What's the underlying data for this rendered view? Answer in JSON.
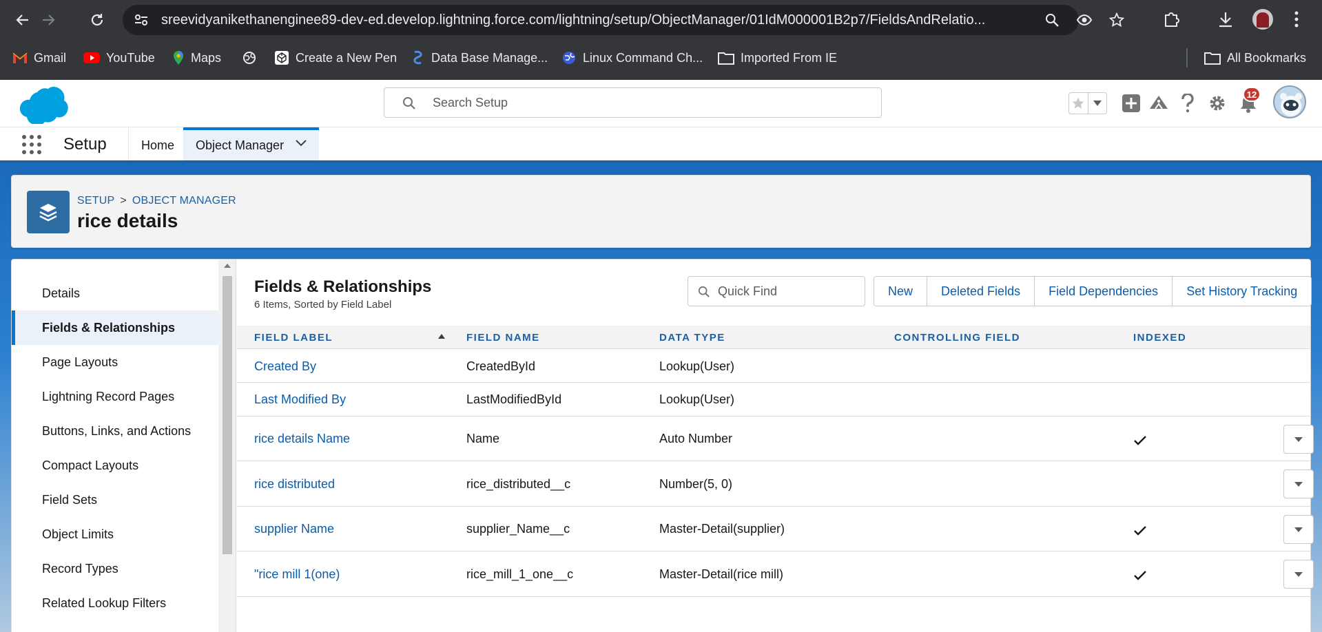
{
  "browser": {
    "url": "sreevidyanikethanenginee89-dev-ed.develop.lightning.force.com/lightning/setup/ObjectManager/01IdM000001B2p7/FieldsAndRelatio...",
    "bookmarks": [
      {
        "label": "Gmail",
        "icon": "gmail-icon"
      },
      {
        "label": "YouTube",
        "icon": "youtube-icon"
      },
      {
        "label": "Maps",
        "icon": "maps-icon"
      },
      {
        "label": "",
        "icon": "globe-icon"
      },
      {
        "label": "Create a New Pen",
        "icon": "codepen-icon"
      },
      {
        "label": "Data Base Manage...",
        "icon": "database-icon"
      },
      {
        "label": "Linux Command Ch...",
        "icon": "globe-blue-icon"
      },
      {
        "label": "Imported From IE",
        "icon": "folder-icon"
      }
    ],
    "all_bookmarks": "All Bookmarks"
  },
  "header": {
    "search_placeholder": "Search Setup",
    "notification_count": "12"
  },
  "appnav": {
    "app_name": "Setup",
    "tabs": [
      "Home",
      "Object Manager"
    ]
  },
  "page": {
    "breadcrumb": [
      "SETUP",
      "OBJECT MANAGER"
    ],
    "breadcrumb_sep": ">",
    "title": "rice details"
  },
  "sidebar": {
    "items": [
      "Details",
      "Fields & Relationships",
      "Page Layouts",
      "Lightning Record Pages",
      "Buttons, Links, and Actions",
      "Compact Layouts",
      "Field Sets",
      "Object Limits",
      "Record Types",
      "Related Lookup Filters"
    ],
    "active": "Fields & Relationships"
  },
  "main": {
    "title": "Fields & Relationships",
    "subtitle": "6 Items, Sorted by Field Label",
    "quick_find_placeholder": "Quick Find",
    "buttons": [
      "New",
      "Deleted Fields",
      "Field Dependencies",
      "Set History Tracking"
    ],
    "columns": [
      "FIELD LABEL",
      "FIELD NAME",
      "DATA TYPE",
      "CONTROLLING FIELD",
      "INDEXED"
    ],
    "rows": [
      {
        "label": "Created By",
        "name": "CreatedById",
        "type": "Lookup(User)",
        "controlling": "",
        "indexed": false,
        "menu": false
      },
      {
        "label": "Last Modified By",
        "name": "LastModifiedById",
        "type": "Lookup(User)",
        "controlling": "",
        "indexed": false,
        "menu": false
      },
      {
        "label": "rice details Name",
        "name": "Name",
        "type": "Auto Number",
        "controlling": "",
        "indexed": true,
        "menu": true
      },
      {
        "label": "rice distributed",
        "name": "rice_distributed__c",
        "type": "Number(5, 0)",
        "controlling": "",
        "indexed": false,
        "menu": true
      },
      {
        "label": "supplier Name",
        "name": "supplier_Name__c",
        "type": "Master-Detail(supplier)",
        "controlling": "",
        "indexed": true,
        "menu": true
      },
      {
        "label": "\"rice mill 1(one)",
        "name": "rice_mill_1_one__c",
        "type": "Master-Detail(rice mill)",
        "controlling": "",
        "indexed": true,
        "menu": true
      }
    ]
  },
  "colors": {
    "brand": "#0176d3",
    "link": "#0b5cab",
    "chrome_bg": "#35363a",
    "object_icon": "#2e6da4"
  }
}
